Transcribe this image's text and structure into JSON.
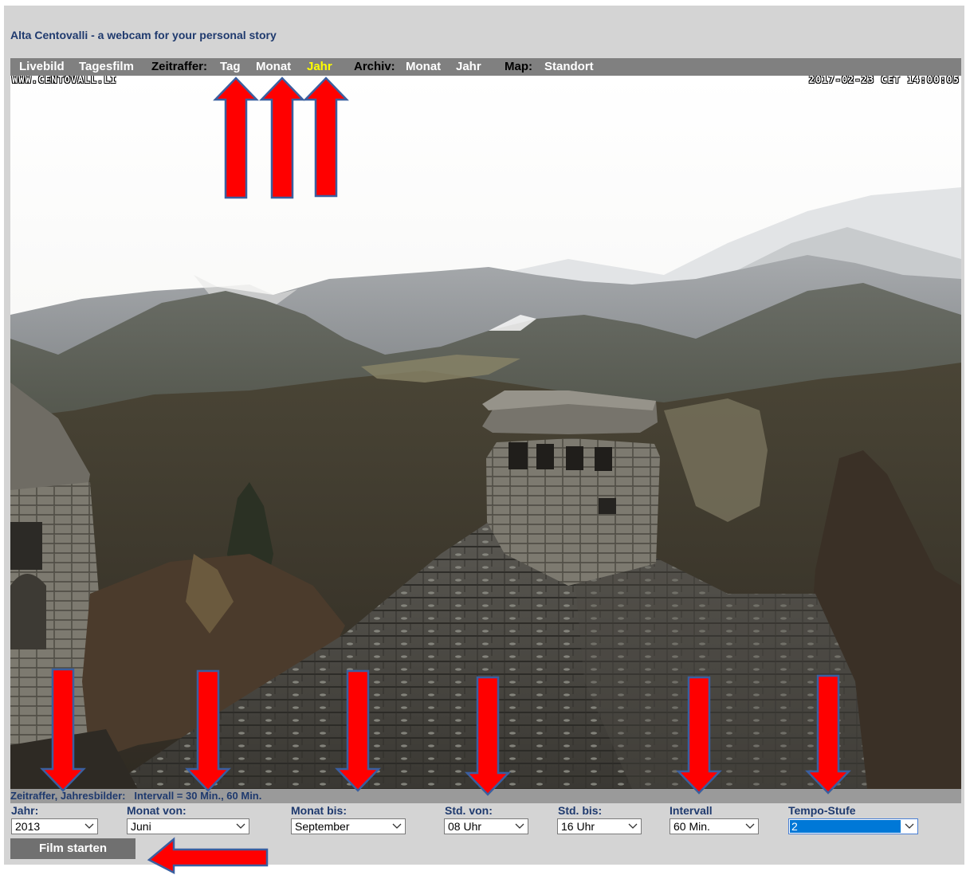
{
  "page": {
    "title": "Alta Centovalli - a webcam for your personal story"
  },
  "nav": {
    "livebild": "Livebild",
    "tagesfilm": "Tagesfilm",
    "zeitraffer_label": "Zeitraffer:",
    "zeitraffer_tag": "Tag",
    "zeitraffer_monat": "Monat",
    "zeitraffer_jahr": "Jahr",
    "archiv_label": "Archiv:",
    "archiv_monat": "Monat",
    "archiv_jahr": "Jahr",
    "map_label": "Map:",
    "map_standort": "Standort",
    "active_item": "zeitraffer_jahr",
    "active_color": "#ffff00"
  },
  "webcam": {
    "watermark": "WWW.CENTOVALL.LI",
    "timestamp": "2017-02-23 CET 14:00:05"
  },
  "info_line": "Zeitraffer, Jahresbilder:   Intervall = 30 Min., 60 Min.",
  "form": {
    "jahr": {
      "label": "Jahr:",
      "value": "2013"
    },
    "monat_von": {
      "label": "Monat von:",
      "value": "Juni"
    },
    "monat_bis": {
      "label": "Monat bis:",
      "value": "September"
    },
    "std_von": {
      "label": "Std. von:",
      "value": "08 Uhr"
    },
    "std_bis": {
      "label": "Std. bis:",
      "value": "16 Uhr"
    },
    "intervall": {
      "label": "Intervall",
      "value": "60 Min."
    },
    "tempo": {
      "label": "Tempo-Stufe",
      "value": "2"
    },
    "start_button": "Film starten"
  },
  "colors": {
    "title_text": "#1f3a6e",
    "nav_bar": "#808080",
    "arrow_fill": "#ff0000",
    "arrow_outline": "#3a5fa0"
  }
}
